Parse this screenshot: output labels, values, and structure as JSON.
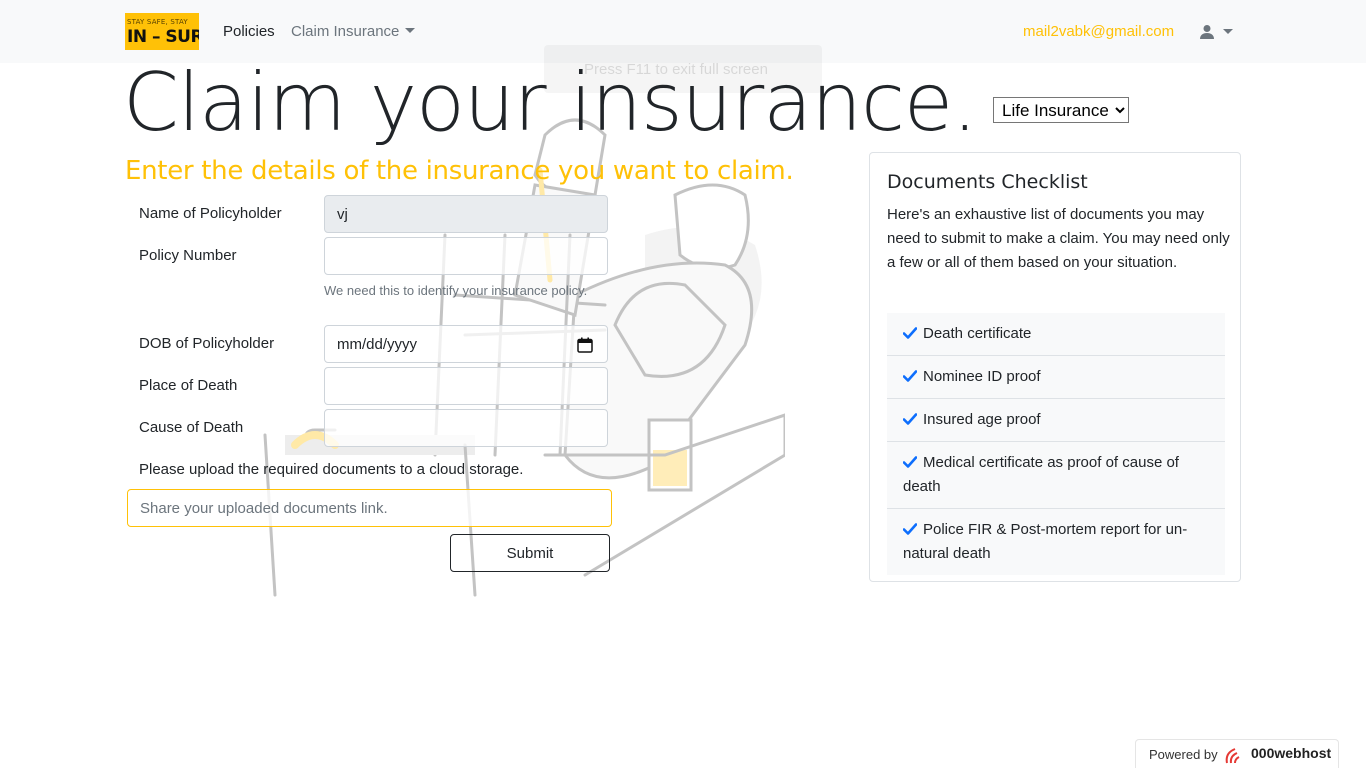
{
  "nav": {
    "logo_tagline": "STAY SAFE, STAY",
    "logo_text": "IN – SURE",
    "policies": "Policies",
    "claim_insurance": "Claim Insurance",
    "email": "mail2vabk@gmail.com"
  },
  "overlay_hint": "Press F11 to exit full screen",
  "hero": {
    "title": "Claim your insurance.",
    "subtitle": "Enter the details of the insurance you want to claim."
  },
  "insurance_type": {
    "selected": "Life Insurance",
    "options": [
      "Life Insurance"
    ]
  },
  "form": {
    "name_label": "Name of Policyholder",
    "name_value": "vj",
    "policy_label": "Policy Number",
    "policy_value": "",
    "policy_help": "We need this to identify your insurance policy.",
    "dob_label": "DOB of Policyholder",
    "dob_placeholder": "mm/dd/yyyy",
    "place_label": "Place of Death",
    "place_value": "",
    "cause_label": "Cause of Death",
    "cause_value": "",
    "upload_text": "Please upload the required documents to a cloud storage.",
    "link_placeholder": "Share your uploaded documents link.",
    "submit": "Submit"
  },
  "checklist": {
    "title": "Documents Checklist",
    "description": "Here's an exhaustive list of documents you may need to submit to make a claim. You may need only a few or all of them based on your situation.",
    "items": [
      "Death certificate",
      "Nominee ID proof",
      "Insured age proof",
      "Medical certificate as proof of cause of death",
      "Police FIR & Post-mortem report for un-natural death"
    ]
  },
  "footer_badge": {
    "prefix": "Powered by",
    "brand": "000webhost"
  },
  "colors": {
    "accent": "#ffc107",
    "check": "#0d6efd",
    "navbar_bg": "#f8f9fa"
  }
}
